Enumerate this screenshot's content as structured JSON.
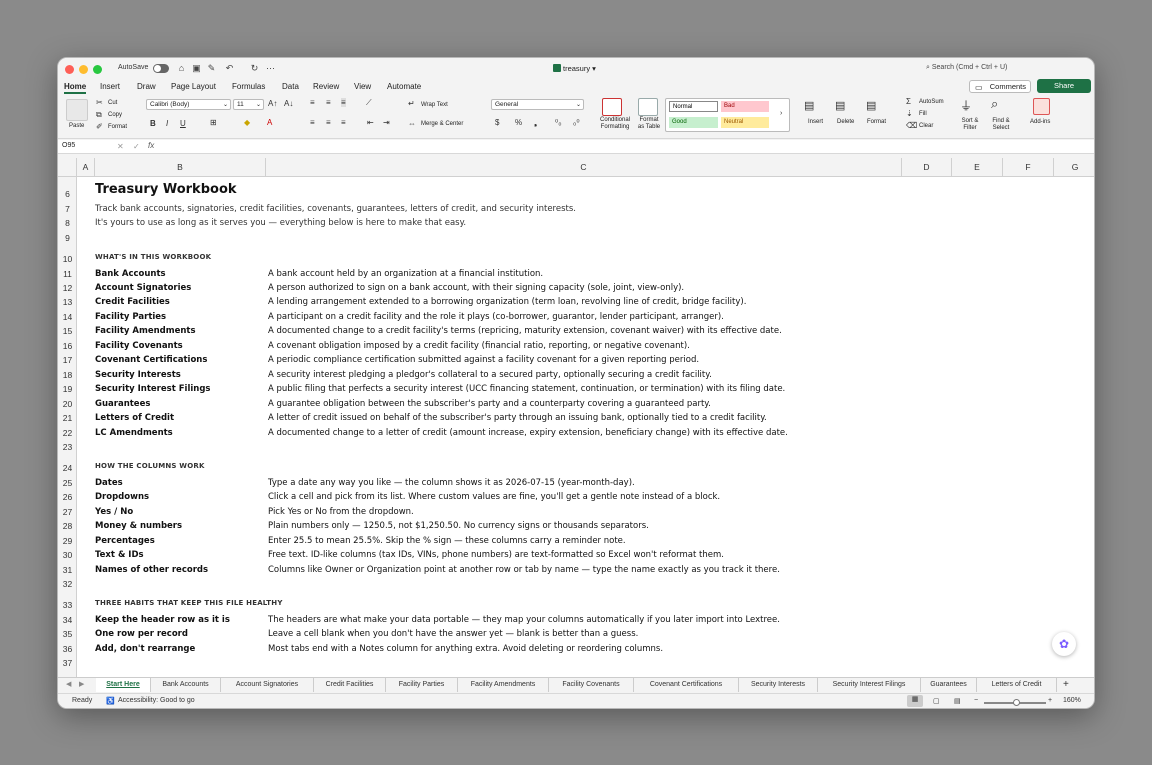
{
  "titlebar": {
    "autosave_label": "AutoSave",
    "doc_title": "treasury",
    "search_placeholder": "Search (Cmd + Ctrl + U)"
  },
  "menu_tabs": [
    "Home",
    "Insert",
    "Draw",
    "Page Layout",
    "Formulas",
    "Data",
    "Review",
    "View",
    "Automate"
  ],
  "comments_label": "Comments",
  "share_label": "Share",
  "ribbon": {
    "paste": "Paste",
    "cut": "Cut",
    "copy": "Copy",
    "format": "Format",
    "font_name": "Calibri (Body)",
    "font_size": "11",
    "wrap_text": "Wrap Text",
    "merge_center": "Merge & Center",
    "number_format": "General",
    "conditional_formatting": "Conditional Formatting",
    "format_as_table": "Format as Table",
    "styles": {
      "normal": "Normal",
      "bad": "Bad",
      "good": "Good",
      "neutral": "Neutral"
    },
    "insert": "Insert",
    "delete": "Delete",
    "format_cells": "Format",
    "autosum": "AutoSum",
    "fill": "Fill",
    "clear": "Clear",
    "sort_filter": "Sort & Filter",
    "find_select": "Find & Select",
    "addins": "Add-ins"
  },
  "formula_bar": {
    "name_box": "O95",
    "fx": "fx"
  },
  "columns": [
    "A",
    "B",
    "C",
    "D",
    "E",
    "F",
    "G"
  ],
  "rows": [
    "6",
    "7",
    "8",
    "9",
    "10",
    "11",
    "12",
    "13",
    "14",
    "15",
    "16",
    "17",
    "18",
    "19",
    "20",
    "21",
    "22",
    "23",
    "24",
    "25",
    "26",
    "27",
    "28",
    "29",
    "30",
    "31",
    "32",
    "33",
    "34",
    "35",
    "36",
    "37"
  ],
  "sheet": {
    "title": "Treasury Workbook",
    "subtitle1": "Track bank accounts, signatories, credit facilities, covenants, guarantees, letters of credit, and security interests.",
    "subtitle2": "It's yours to use as long as it serves you — everything below is here to make that easy.",
    "section1": "WHAT'S IN THIS WORKBOOK",
    "items1": [
      {
        "name": "Bank Accounts",
        "desc": "A bank account held by an organization at a financial institution."
      },
      {
        "name": "Account Signatories",
        "desc": "A person authorized to sign on a bank account, with their signing capacity (sole, joint, view-only)."
      },
      {
        "name": "Credit Facilities",
        "desc": "A lending arrangement extended to a borrowing organization (term loan, revolving line of credit, bridge facility)."
      },
      {
        "name": "Facility Parties",
        "desc": "A participant on a credit facility and the role it plays (co-borrower, guarantor, lender participant, arranger)."
      },
      {
        "name": "Facility Amendments",
        "desc": "A documented change to a credit facility's terms (repricing, maturity extension, covenant waiver) with its effective date."
      },
      {
        "name": "Facility Covenants",
        "desc": "A covenant obligation imposed by a credit facility (financial ratio, reporting, or negative covenant)."
      },
      {
        "name": "Covenant Certifications",
        "desc": "A periodic compliance certification submitted against a facility covenant for a given reporting period."
      },
      {
        "name": "Security Interests",
        "desc": "A security interest pledging a pledgor's collateral to a secured party, optionally securing a credit facility."
      },
      {
        "name": "Security Interest Filings",
        "desc": "A public filing that perfects a security interest (UCC financing statement, continuation, or termination) with its filing date."
      },
      {
        "name": "Guarantees",
        "desc": "A guarantee obligation between the subscriber's party and a counterparty covering a guaranteed party."
      },
      {
        "name": "Letters of Credit",
        "desc": "A letter of credit issued on behalf of the subscriber's party through an issuing bank, optionally tied to a credit facility."
      },
      {
        "name": "LC Amendments",
        "desc": "A documented change to a letter of credit (amount increase, expiry extension, beneficiary change) with its effective date."
      }
    ],
    "section2": "HOW THE COLUMNS WORK",
    "items2": [
      {
        "name": "Dates",
        "desc": "Type a date any way you like — the column shows it as 2026-07-15 (year-month-day)."
      },
      {
        "name": "Dropdowns",
        "desc": "Click a cell and pick from its list. Where custom values are fine, you'll get a gentle note instead of a block."
      },
      {
        "name": "Yes / No",
        "desc": "Pick Yes or No from the dropdown."
      },
      {
        "name": "Money & numbers",
        "desc": "Plain numbers only — 1250.5, not $1,250.50. No currency signs or thousands separators."
      },
      {
        "name": "Percentages",
        "desc": "Enter 25.5 to mean 25.5%. Skip the % sign — these columns carry a reminder note."
      },
      {
        "name": "Text & IDs",
        "desc": "Free text. ID-like columns (tax IDs, VINs, phone numbers) are text-formatted so Excel won't reformat them."
      },
      {
        "name": "Names of other records",
        "desc": "Columns like Owner or Organization point at another row or tab by name — type the name exactly as you track it there."
      }
    ],
    "section3": "THREE HABITS THAT KEEP THIS FILE HEALTHY",
    "items3": [
      {
        "name": "Keep the header row as it is",
        "desc": "The headers are what make your data portable — they map your columns automatically if you later import into Lextree."
      },
      {
        "name": "One row per record",
        "desc": "Leave a cell blank when you don't have the answer yet — blank is better than a guess."
      },
      {
        "name": "Add, don't rearrange",
        "desc": "Most tabs end with a Notes column for anything extra. Avoid deleting or reordering columns."
      }
    ]
  },
  "sheet_tabs": [
    "Start Here",
    "Bank Accounts",
    "Account Signatories",
    "Credit Facilities",
    "Facility Parties",
    "Facility Amendments",
    "Facility Covenants",
    "Covenant Certifications",
    "Security Interests",
    "Security Interest Filings",
    "Guarantees",
    "Letters of Credit"
  ],
  "status": {
    "ready": "Ready",
    "accessibility": "Accessibility: Good to go",
    "zoom": "160%"
  }
}
